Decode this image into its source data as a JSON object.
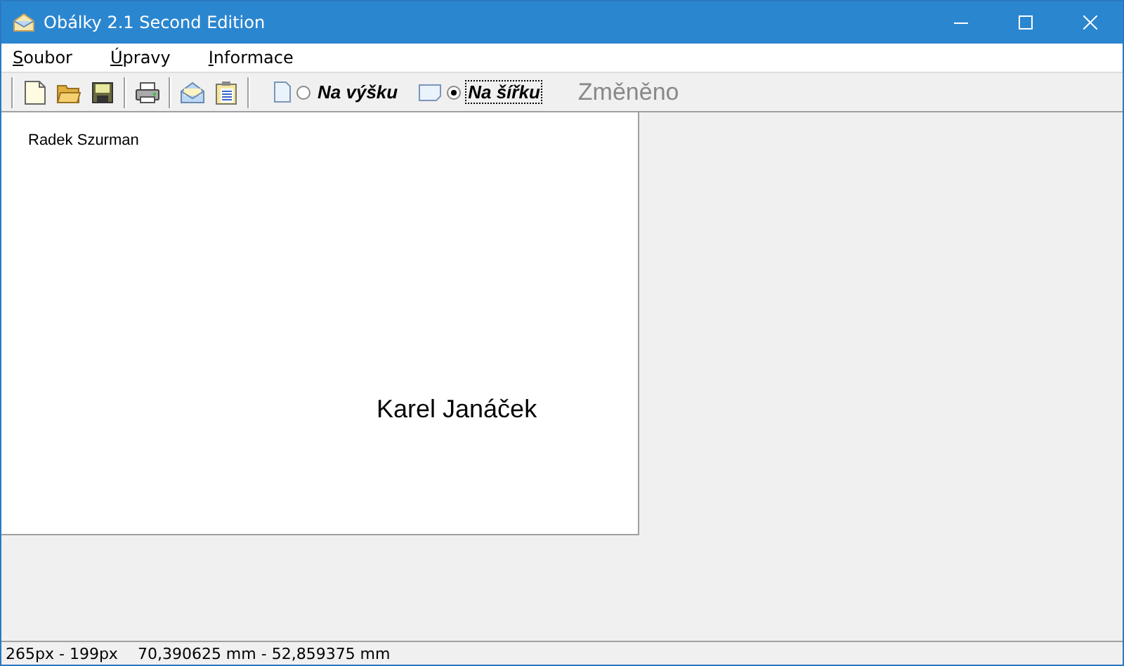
{
  "window": {
    "title": "Obálky 2.1 Second Edition"
  },
  "menu": [
    "Soubor",
    "Úpravy",
    "Informace"
  ],
  "orientation": [
    {
      "label": "Na výšku",
      "selected": false,
      "kind": "portrait"
    },
    {
      "label": "Na šířku",
      "selected": true,
      "kind": "landscape"
    }
  ],
  "modified_label": "Změněno",
  "envelope": {
    "sender": "Radek Szurman",
    "recipient": "Karel Janáček"
  },
  "status_bar": {
    "pixels": "265px - 199px",
    "millimeters": "70,390625 mm - 52,859375 mm"
  }
}
